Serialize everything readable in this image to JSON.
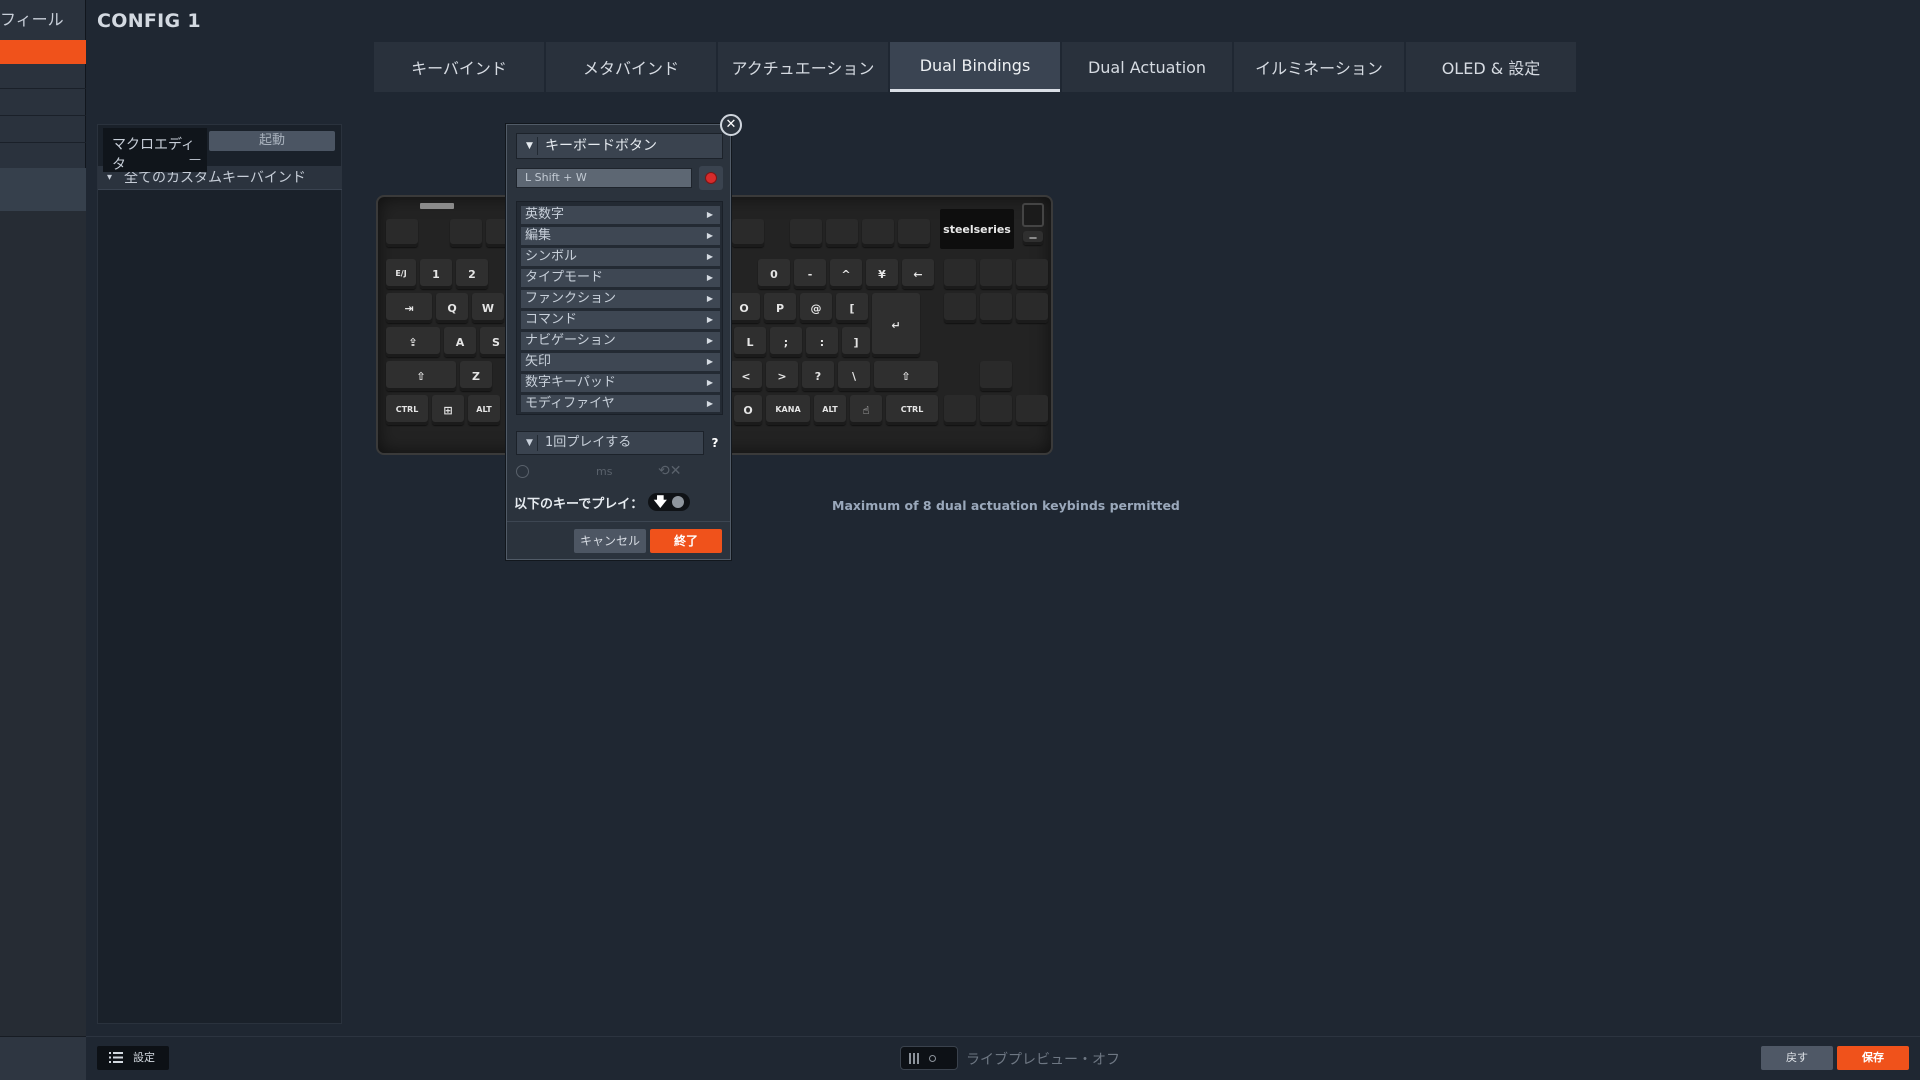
{
  "sidebar": {
    "profile_label": "フィール"
  },
  "header": {
    "config_title": "CONFIG 1"
  },
  "tabs": [
    {
      "label": "キーバインド"
    },
    {
      "label": "メタバインド"
    },
    {
      "label": "アクチュエーション"
    },
    {
      "label": "Dual Bindings",
      "active": true
    },
    {
      "label": "Dual Actuation"
    },
    {
      "label": "イルミネーション"
    },
    {
      "label": "OLED & 設定"
    }
  ],
  "macro_panel": {
    "editor_label": "マクロエディタ",
    "editor_dash": "—",
    "launch_label": "起動",
    "custom_keybinds_label": "全てのカスタムキーバインド"
  },
  "keyboard": {
    "brand_logo": "steelseries",
    "keys": {
      "r1": [
        "E/J",
        "1",
        "2",
        "",
        "",
        "",
        "",
        "",
        "",
        "0",
        "-",
        "^",
        "¥",
        "←"
      ],
      "r2": [
        "⇥",
        "Q",
        "W",
        "",
        "",
        "",
        "",
        "",
        "O",
        "P",
        "@",
        "[",
        "↵"
      ],
      "r3": [
        "⇪",
        "A",
        "S",
        "",
        "",
        "",
        "",
        "",
        "L",
        ";",
        ":",
        "]"
      ],
      "r4": [
        "⇧",
        "Z",
        "",
        "",
        "",
        "",
        "",
        "",
        "<",
        ">",
        "?",
        "\\",
        "⇧"
      ],
      "r5": [
        "CTRL",
        "⊞",
        "ALT",
        "",
        "",
        "",
        "",
        "O",
        "KANA",
        "ALT",
        "☝",
        "CTRL"
      ]
    }
  },
  "dual_actuation_note": "Maximum of 8 dual actuation keybinds permitted",
  "popup": {
    "type_select": "キーボードボタン",
    "key_value": "L Shift + W",
    "categories": [
      {
        "label": "英数字"
      },
      {
        "label": "編集"
      },
      {
        "label": "シンボル"
      },
      {
        "label": "タイプモード"
      },
      {
        "label": "ファンクション"
      },
      {
        "label": "コマンド"
      },
      {
        "label": "ナビゲーション"
      },
      {
        "label": "矢印"
      },
      {
        "label": "数字キーパッド"
      },
      {
        "label": "モディファイヤ"
      }
    ],
    "play_mode": "1回プレイする",
    "help": "?",
    "ms_label": "ms",
    "play_with_key_label": "以下のキーでプレイ：",
    "cancel_label": "キャンセル",
    "finish_label": "終了",
    "close_symbol": "✕"
  },
  "footer": {
    "settings_label": "設定",
    "live_preview_label": "ライブプレビュー・オフ",
    "back_label": "戻す",
    "save_label": "保存"
  },
  "colors": {
    "accent": "#f0521b",
    "background": "#1f2732",
    "record": "#d72b2b"
  }
}
